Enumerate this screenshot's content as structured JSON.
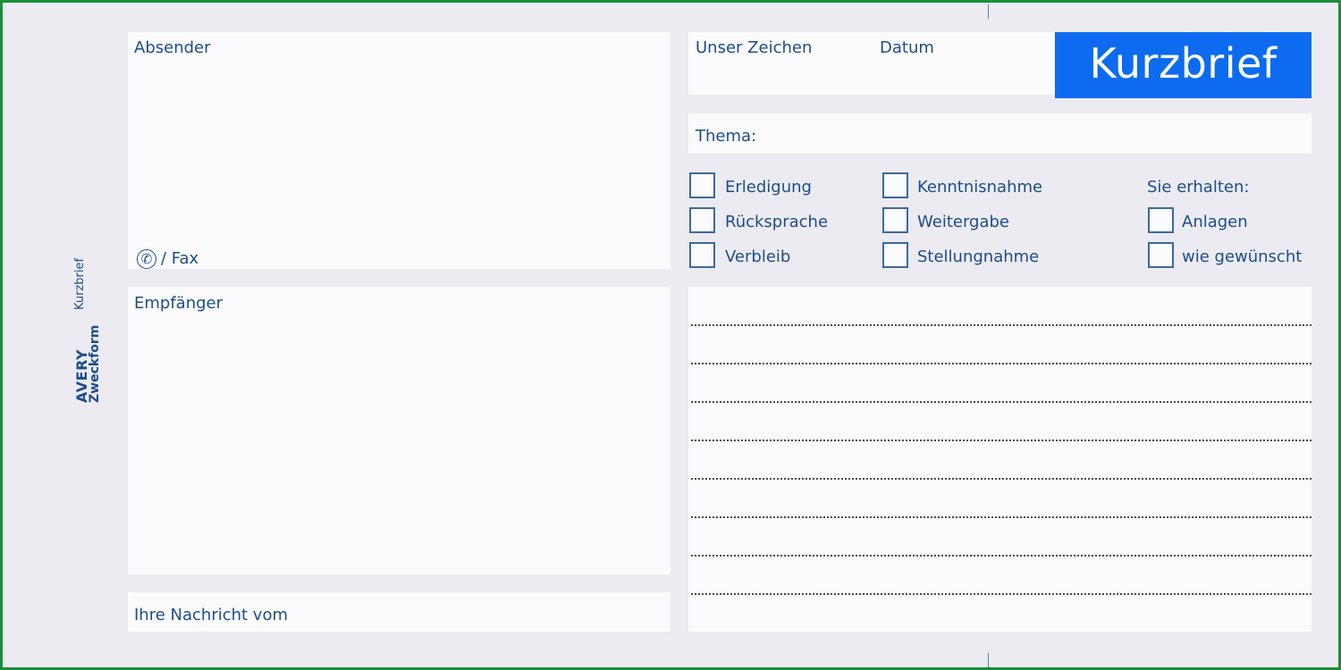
{
  "form": {
    "title": "Kurzbrief",
    "sender_label": "Absender",
    "phone_fax_label": "/ Fax",
    "recipient_label": "Empfänger",
    "your_message_label": "Ihre Nachricht vom",
    "our_ref_label": "Unser Zeichen",
    "date_label": "Datum",
    "subject_label": "Thema:",
    "you_receive_label": "Sie erhalten:"
  },
  "checkboxes": {
    "col1": [
      "Erledigung",
      "Rücksprache",
      "Verbleib"
    ],
    "col2": [
      "Kenntnisnahme",
      "Weitergabe",
      "Stellungnahme"
    ],
    "col3": [
      "Anlagen",
      "wie gewünscht"
    ]
  },
  "brand": {
    "product": "Kurzbrief",
    "logo_line1": "AVERY",
    "logo_line2": "Zweckform"
  },
  "icons": {
    "phone": "phone-icon"
  },
  "colors": {
    "accent": "#0c6bf0",
    "text": "#1c4e8a",
    "frame": "#1a8f3a"
  }
}
